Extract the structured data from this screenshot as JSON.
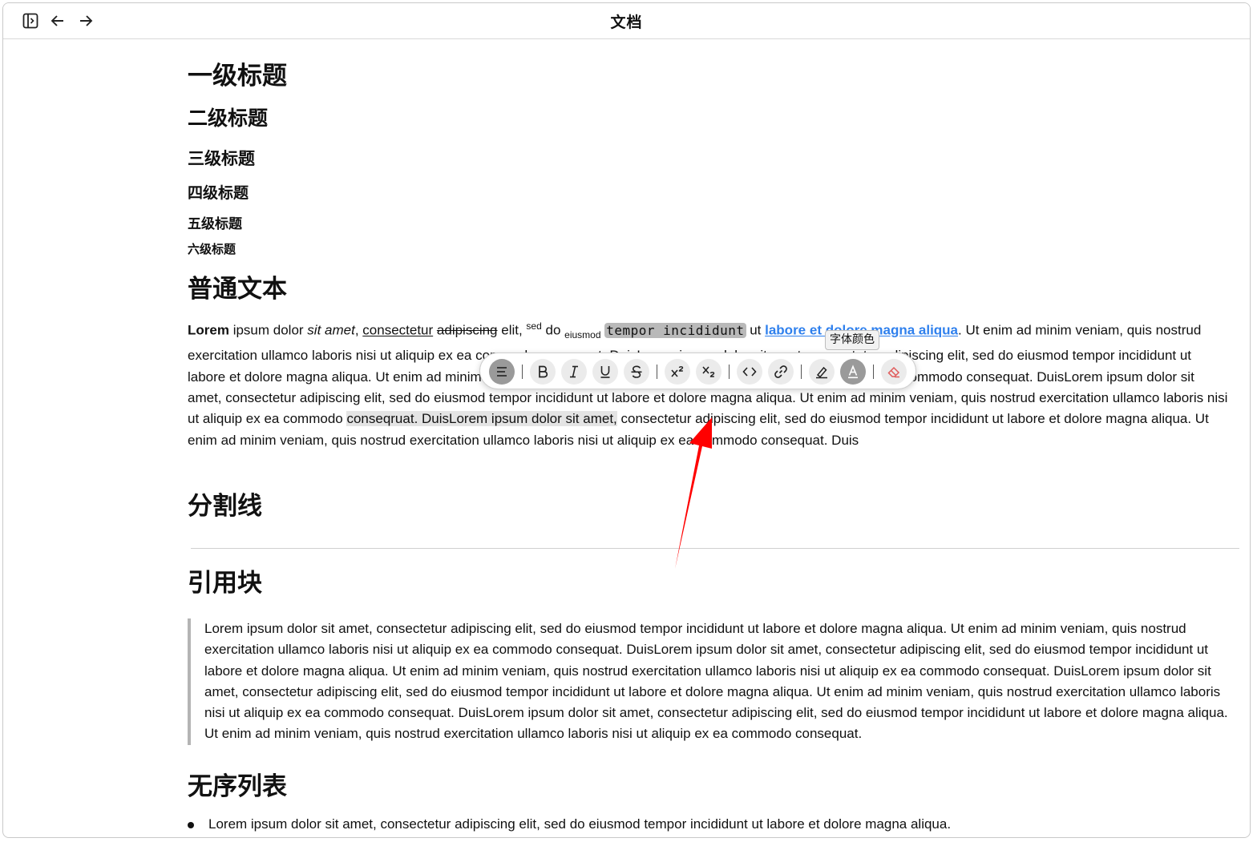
{
  "window": {
    "title": "文档"
  },
  "headings": {
    "h1": "一级标题",
    "h2": "二级标题",
    "h3": "三级标题",
    "h4": "四级标题",
    "h5": "五级标题",
    "h6": "六级标题",
    "normal_text": "普通文本",
    "divider": "分割线",
    "quote": "引用块",
    "unordered_list": "无序列表"
  },
  "paragraph": {
    "bold": "Lorem",
    "t1": " ipsum dolor ",
    "italic": "sit amet",
    "t2": ", ",
    "underline": "consectetur",
    "t3": " ",
    "strike": "adipiscing",
    "t4": " elit, ",
    "sup": "sed",
    "t5": " do ",
    "sub": "eiusmod",
    "t6": " ",
    "code": "tempor incididunt",
    "t7": " ut ",
    "link": "labore et dolore magna aliqua",
    "t8": ". Ut enim ad minim veniam, quis nostrud exercitation ullamco laboris nisi ut aliquip ex ea commodo consequat. DuisLorem ipsum dolor sit amet, consectetur adipiscing elit, sed do eiusmod tempor incididunt ut labore et dolore magna aliqua. Ut enim ad minim veniam, quis nostrud exercitation ullamco laboris nisi ut aliquip ex ea commodo consequat. DuisLorem ipsum dolor sit amet, consectetur adipiscing elit, sed do eiusmod tempor incididunt ut labore et dolore magna aliqua. Ut enim ad minim veniam, quis nostrud exercitation ullamco laboris nisi ut aliquip ex ea commodo ",
    "selected": "conseqruat. DuisLorem ipsum dolor sit amet,",
    "t9": " consectetur adipiscing elit, sed do eiusmod tempor incididunt ut labore et dolore magna aliqua. Ut enim ad minim veniam, quis nostrud exercitation ullamco laboris nisi ut aliquip ex ea commodo consequat. Duis"
  },
  "quote_text": "Lorem ipsum dolor sit amet, consectetur adipiscing elit, sed do eiusmod tempor incididunt ut labore et dolore magna aliqua. Ut enim ad minim veniam, quis nostrud exercitation ullamco laboris nisi ut aliquip ex ea commodo consequat. DuisLorem ipsum dolor sit amet, consectetur adipiscing elit, sed do eiusmod tempor incididunt ut labore et dolore magna aliqua. Ut enim ad minim veniam, quis nostrud exercitation ullamco laboris nisi ut aliquip ex ea commodo consequat. DuisLorem ipsum dolor sit amet, consectetur adipiscing elit, sed do eiusmod tempor incididunt ut labore et dolore magna aliqua. Ut enim ad minim veniam, quis nostrud exercitation ullamco laboris nisi ut aliquip ex ea commodo consequat. DuisLorem ipsum dolor sit amet, consectetur adipiscing elit, sed do eiusmod tempor incididunt ut labore et dolore magna aliqua. Ut enim ad minim veniam, quis nostrud exercitation ullamco laboris nisi ut aliquip ex ea commodo consequat.",
  "list_items": [
    "Lorem ipsum dolor sit amet, consectetur adipiscing elit, sed do eiusmod tempor incididunt ut labore et dolore magna aliqua."
  ],
  "toolbar": {
    "tooltip": "字体颜色",
    "buttons": [
      "align-icon",
      "bold-icon",
      "italic-icon",
      "underline-icon",
      "strikethrough-icon",
      "superscript-icon",
      "subscript-icon",
      "code-icon",
      "link-icon",
      "highlight-icon",
      "font-color-icon",
      "clear-format-icon"
    ],
    "active": [
      "align-icon",
      "font-color-icon"
    ]
  },
  "colors": {
    "link": "#2f80ed",
    "code_bg": "#b9b9b9",
    "selection_bg": "#e4e4e4",
    "annotation_arrow": "#ff0000",
    "eraser": "#e05a5a"
  }
}
